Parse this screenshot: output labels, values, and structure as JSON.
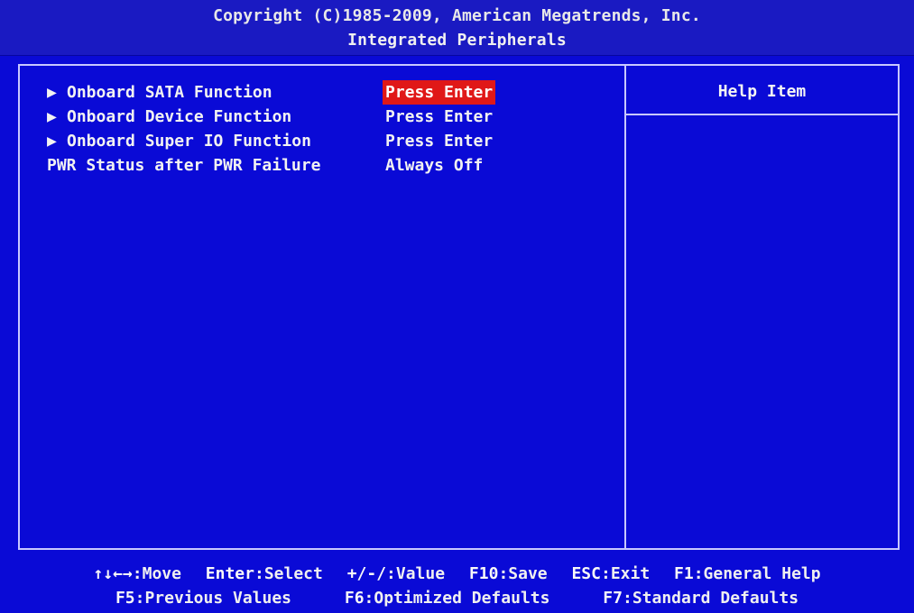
{
  "header": {
    "copyright": "Copyright (C)1985-2009, American Megatrends, Inc.",
    "title": "Integrated Peripherals"
  },
  "menu": {
    "items": [
      {
        "label": "Onboard SATA Function",
        "value": "Press Enter",
        "submenu": true,
        "selected": true
      },
      {
        "label": "Onboard Device Function",
        "value": "Press Enter",
        "submenu": true,
        "selected": false
      },
      {
        "label": "Onboard Super IO Function",
        "value": "Press Enter",
        "submenu": true,
        "selected": false
      },
      {
        "label": "PWR Status after PWR Failure",
        "value": "Always Off",
        "submenu": false,
        "selected": false
      }
    ],
    "submenu_arrow_icon": "triangle-right-icon"
  },
  "help": {
    "title": "Help Item"
  },
  "footer": {
    "line1": [
      {
        "key": "↑↓←→",
        "action": ":Move"
      },
      {
        "key": "Enter",
        "action": ":Select"
      },
      {
        "key": "+/-/",
        "action": ":Value"
      },
      {
        "key": "F10",
        "action": ":Save"
      },
      {
        "key": "ESC",
        "action": ":Exit"
      },
      {
        "key": "F1",
        "action": ":General Help"
      }
    ],
    "line2": [
      {
        "key": "F5",
        "action": ":Previous Values"
      },
      {
        "key": "F6",
        "action": ":Optimized Defaults"
      },
      {
        "key": "F7",
        "action": ":Standard Defaults"
      }
    ]
  },
  "colors": {
    "background": "#0a0ad6",
    "header": "#1a1ac2",
    "highlight": "#e01818",
    "border": "#c8c8ff"
  }
}
